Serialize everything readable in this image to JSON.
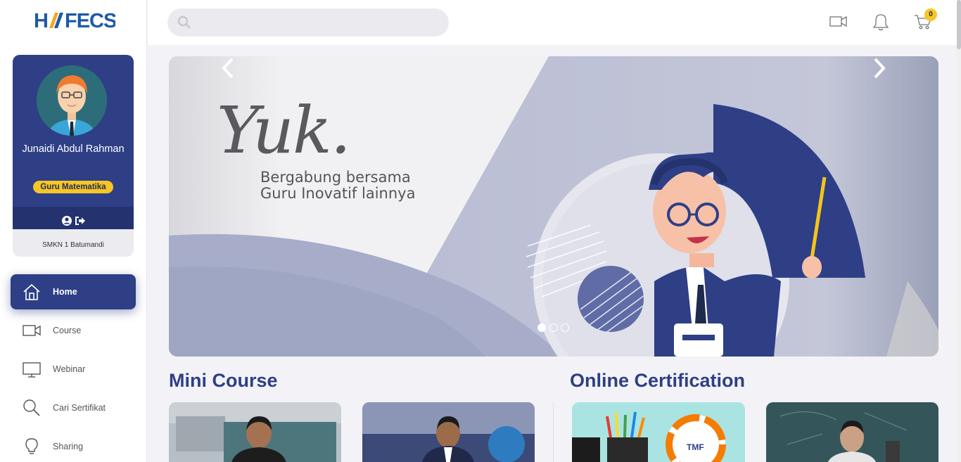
{
  "brand": {
    "logo_text": "HAFECS",
    "primary_color": "#2e3f86",
    "accent_color": "#f6c624"
  },
  "profile": {
    "name": "Junaidi Abdul Rahman",
    "role": "Guru Matematika",
    "school": "SMKN 1 Batumandi"
  },
  "nav": [
    {
      "label": "Home",
      "icon": "home-icon",
      "active": true
    },
    {
      "label": "Course",
      "icon": "video-icon"
    },
    {
      "label": "Webinar",
      "icon": "monitor-icon"
    },
    {
      "label": "Cari Sertifikat",
      "icon": "search-icon"
    },
    {
      "label": "Sharing",
      "icon": "lightbulb-icon"
    }
  ],
  "topbar": {
    "search_placeholder": "",
    "cart_count": "0"
  },
  "banner": {
    "headline": "Yuk.",
    "line1": "Bergabung bersama",
    "line2": "Guru Inovatif lainnya",
    "slide_count": 3,
    "active_slide": 1
  },
  "sections": {
    "mini_course": "Mini Course",
    "online_certification": "Online Certification"
  }
}
